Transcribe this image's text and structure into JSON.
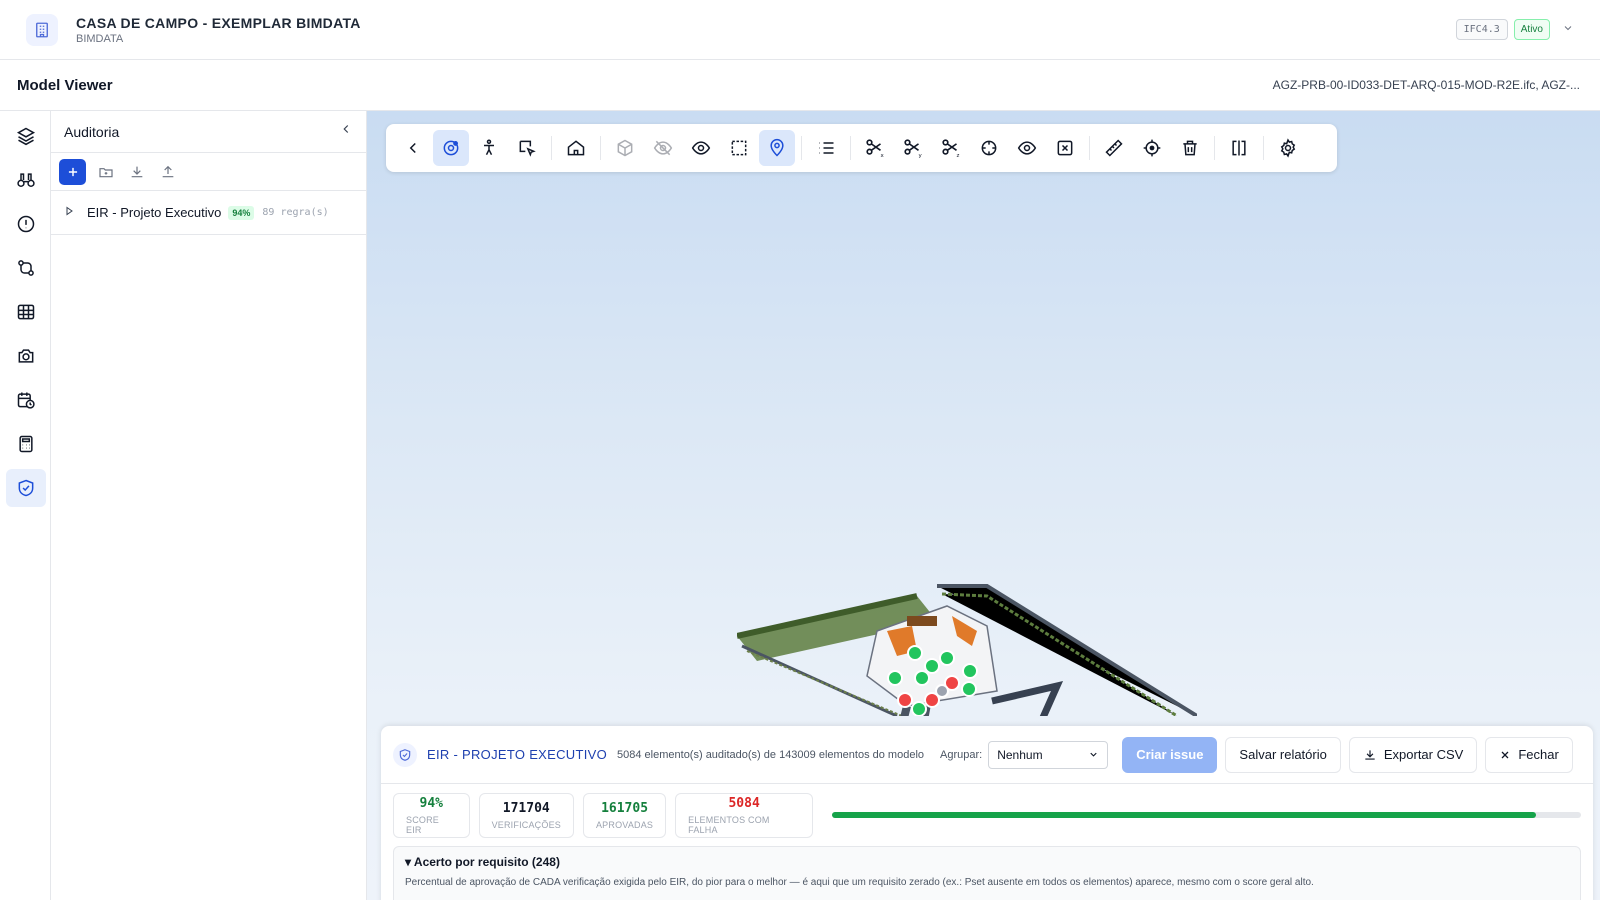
{
  "header": {
    "title": "CASA DE CAMPO - EXEMPLAR BIMDATA",
    "subtitle": "BIMDATA",
    "ifc_version": "IFC4.3",
    "status": "Ativo"
  },
  "subheader": {
    "title": "Model Viewer",
    "model_files": "AGZ-PRB-00-ID033-DET-ARQ-015-MOD-R2E.ifc, AGZ-..."
  },
  "panel": {
    "title": "Auditoria",
    "tree": [
      {
        "label": "EIR - Projeto Executivo",
        "badge": "94%",
        "rules": "89 regra(s)"
      }
    ]
  },
  "audit": {
    "title": "EIR - PROJETO EXECUTIVO",
    "description": "5084 elemento(s) auditado(s) de 143009 elementos do modelo",
    "group_label": "Agrupar:",
    "group_value": "Nenhum",
    "create_issue": "Criar issue",
    "save_report": "Salvar relatório",
    "export_csv": "Exportar CSV",
    "close": "Fechar",
    "stats": [
      {
        "value": "94%",
        "label": "SCORE EIR",
        "color": "#15803d"
      },
      {
        "value": "171704",
        "label": "VERIFICAÇÕES",
        "color": "#111827"
      },
      {
        "value": "161705",
        "label": "APROVADAS",
        "color": "#15803d"
      },
      {
        "value": "5084",
        "label": "ELEMENTOS COM FALHA",
        "color": "#dc2626"
      }
    ],
    "progress": 0.94,
    "requirements_title": "▾ Acerto por requisito (248)",
    "requirements_desc": "Percentual de aprovação de CADA verificação exigida pelo EIR, do pior para o melhor — é aqui que um requisito zerado (ex.: Pset ausente em todos os elementos) aparece, mesmo com o score geral alto."
  },
  "colors": {
    "accent": "#1d4ed8",
    "success": "#16a34a",
    "danger": "#dc2626"
  }
}
